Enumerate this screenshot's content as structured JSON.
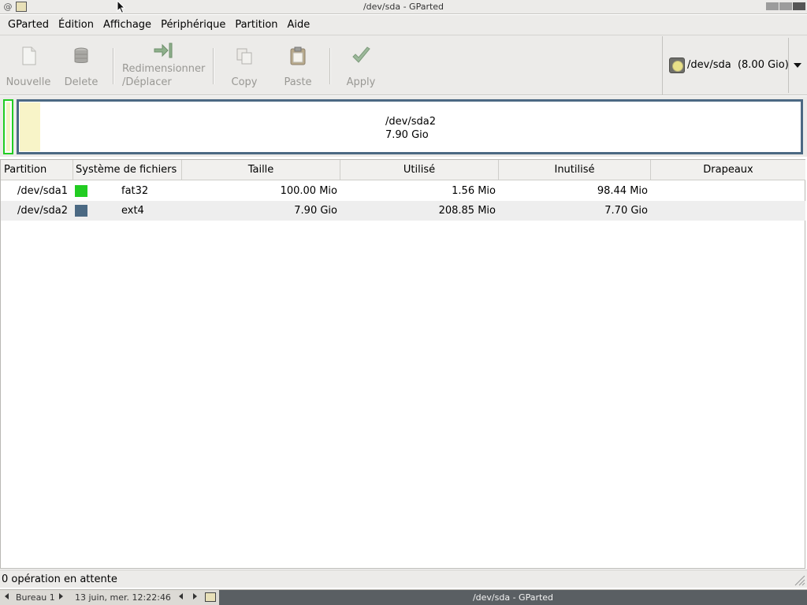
{
  "window": {
    "title": "/dev/sda - GParted"
  },
  "menu": {
    "items": [
      {
        "label": "GParted"
      },
      {
        "label": "Édition"
      },
      {
        "label": "Affichage"
      },
      {
        "label": "Périphérique"
      },
      {
        "label": "Partition"
      },
      {
        "label": "Aide"
      }
    ]
  },
  "toolbar": {
    "new_label": "Nouvelle",
    "delete_label": "Delete",
    "resize_label_line1": "Redimensionner",
    "resize_label_line2": "/Déplacer",
    "copy_label": "Copy",
    "paste_label": "Paste",
    "apply_label": "Apply",
    "disabled_color": "#999894"
  },
  "device": {
    "label": "/dev/sda  (8.00 Gio)"
  },
  "disk_map": {
    "partition_name": "/dev/sda2",
    "partition_size": "7.90 Gio",
    "border_color": "#4b6983",
    "small_partition_color": "#22cc22"
  },
  "table": {
    "headers": {
      "partition": "Partition",
      "filesystem": "Système de fichiers",
      "size": "Taille",
      "used": "Utilisé",
      "unused": "Inutilisé",
      "flags": "Drapeaux"
    },
    "rows": [
      {
        "partition": "/dev/sda1",
        "fs_color": "#22cc22",
        "filesystem": "fat32",
        "size": "100.00 Mio",
        "used": "1.56 Mio",
        "unused": "98.44 Mio",
        "flags": ""
      },
      {
        "partition": "/dev/sda2",
        "fs_color": "#4b6983",
        "filesystem": "ext4",
        "size": "7.90 Gio",
        "used": "208.85 Mio",
        "unused": "7.70 Gio",
        "flags": ""
      }
    ]
  },
  "status": {
    "text": "0 opération en attente"
  },
  "panel": {
    "desktop": "Bureau 1",
    "clock": "13 juin, mer. 12:22:46",
    "task_title": "/dev/sda - GParted"
  }
}
